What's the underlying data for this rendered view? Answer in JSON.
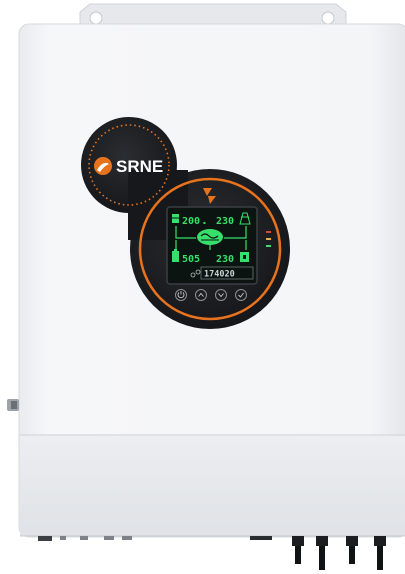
{
  "brand": {
    "logo_text": "SRNE"
  },
  "lcd": {
    "pv_value": "200",
    "grid_value": "230",
    "battery_value": "505",
    "load_value": "230",
    "energy_value": "174020"
  },
  "colors": {
    "body": "#f4f5f7",
    "accent": "#e8731e",
    "panel": "#16181b",
    "lcd_green": "#37e06a",
    "lcd_bg": "#0c1412"
  },
  "buttons": [
    {
      "icon": "power-icon"
    },
    {
      "icon": "up-arrow-icon"
    },
    {
      "icon": "down-arrow-icon"
    },
    {
      "icon": "enter-icon"
    }
  ]
}
